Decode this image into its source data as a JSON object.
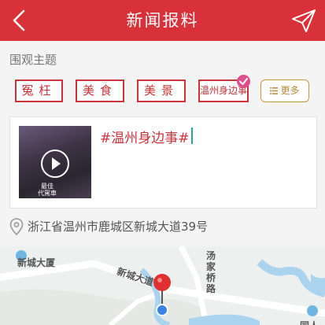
{
  "header": {
    "title": "新闻报料",
    "back_icon": "chevron-left-icon",
    "send_icon": "send-icon",
    "bg_color": "#d8313a"
  },
  "topics": {
    "label": "围观主题",
    "tags": [
      "冤枉",
      "美食",
      "美景",
      "温州身边事"
    ],
    "selected": "温州身边事",
    "more_label": "更多",
    "accent_color": "#c9333a"
  },
  "post": {
    "text": "#温州身边事#",
    "video_caption_line1": "最佳",
    "video_caption_line2": "代駕車"
  },
  "location": {
    "address": "浙江省温州市鹿城区新城大道39号"
  },
  "map": {
    "labels": {
      "building_1": "新城大厦",
      "road_1": "新城大道",
      "road_2": "汤家桥路",
      "building_2": "同人"
    }
  }
}
